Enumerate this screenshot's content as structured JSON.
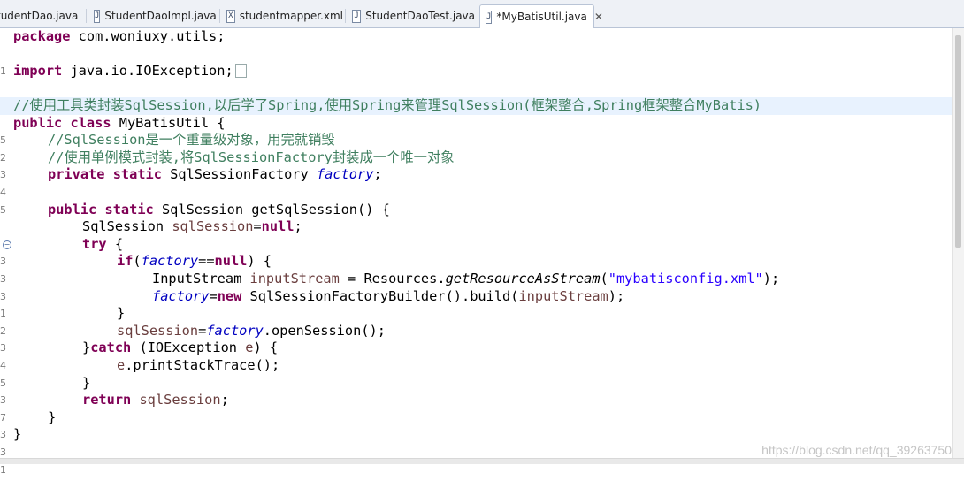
{
  "tabs": [
    {
      "label": "tudentDao.java",
      "icon": "J",
      "active": false
    },
    {
      "label": "StudentDaoImpl.java",
      "icon": "J",
      "active": false
    },
    {
      "label": "studentmapper.xml",
      "icon": "X",
      "active": false
    },
    {
      "label": "StudentDaoTest.java",
      "icon": "J",
      "active": false
    },
    {
      "label": "*MyBatisUtil.java",
      "icon": "J",
      "active": true,
      "close": "✕"
    }
  ],
  "gutter": [
    "1",
    "",
    "3",
    "",
    "5",
    "2",
    "3",
    "4",
    "5",
    "",
    "7",
    "3",
    "3",
    "3",
    "1",
    "2",
    "3",
    "4",
    "5",
    "3",
    "7",
    "3",
    "3",
    "",
    "1"
  ],
  "code": {
    "l1_kw": "package",
    "l1_rest": " com.woniuxy.utils;",
    "l3_kw": "import",
    "l3_rest": " java.io.IOException;",
    "l5_comment": "//使用工具类封装SqlSession,以后学了Spring,使用Spring来管理SqlSession(框架整合,Spring框架整合MyBatis)",
    "l6_kw1": "public",
    "l6_kw2": "class",
    "l6_rest": " MyBatisUtil {",
    "l7_comment": "//SqlSession是一个重量级对象，用完就销毁",
    "l8_comment": "//使用单例模式封装,将SqlSessionFactory封装成一个唯一对象",
    "l9_kw1": "private",
    "l9_kw2": "static",
    "l9_type": " SqlSessionFactory ",
    "l9_field": "factory",
    "l9_end": ";",
    "l11_kw1": "public",
    "l11_kw2": "static",
    "l11_rest": " SqlSession getSqlSession() {",
    "l12_type": "SqlSession ",
    "l12_var": "sqlSession",
    "l12_eq": "=",
    "l12_kw": "null",
    "l12_end": ";",
    "l13_kw": "try",
    "l13_rest": " {",
    "l14_kw": "if",
    "l14_open": "(",
    "l14_field": "factory",
    "l14_eq": "==",
    "l14_kw2": "null",
    "l14_end": ") {",
    "l15_type": "InputStream ",
    "l15_var": "inputStream",
    "l15_mid": " = Resources.",
    "l15_method": "getResourceAsStream",
    "l15_open": "(",
    "l15_str": "\"mybatisconfig.xml\"",
    "l15_end": ");",
    "l16_field": "factory",
    "l16_eq": "=",
    "l16_kw": "new",
    "l16_mid": " SqlSessionFactoryBuilder().build(",
    "l16_var": "inputStream",
    "l16_end": ");",
    "l17_text": "}",
    "l18_var": "sqlSession",
    "l18_eq": "=",
    "l18_field": "factory",
    "l18_end": ".openSession();",
    "l19_open": "}",
    "l19_kw": "catch",
    "l19_mid": " (IOException ",
    "l19_var": "e",
    "l19_end": ") {",
    "l20_var": "e",
    "l20_end": ".printStackTrace();",
    "l21_text": "}",
    "l22_kw": "return",
    "l22_var": " sqlSession",
    "l22_end": ";",
    "l23_text": "}",
    "l24_text": "}"
  },
  "watermark": "https://blog.csdn.net/qq_39263750"
}
